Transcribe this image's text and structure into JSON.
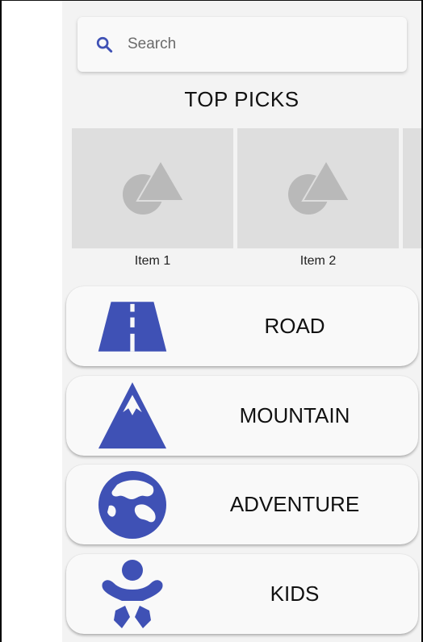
{
  "search": {
    "placeholder": "Search",
    "icon": "search-icon"
  },
  "top_picks": {
    "title": "TOP PICKS",
    "items": [
      {
        "label": "Item 1",
        "icon": "image-placeholder-icon"
      },
      {
        "label": "Item 2",
        "icon": "image-placeholder-icon"
      },
      {
        "label": "",
        "icon": "image-placeholder-icon"
      }
    ]
  },
  "categories": [
    {
      "label": "ROAD",
      "icon": "road-icon"
    },
    {
      "label": "MOUNTAIN",
      "icon": "mountain-icon"
    },
    {
      "label": "ADVENTURE",
      "icon": "globe-icon"
    },
    {
      "label": "KIDS",
      "icon": "baby-icon"
    }
  ],
  "colors": {
    "accent": "#3f51b5",
    "placeholder_shape": "#b9b9b9",
    "thumb_bg": "#dedede"
  }
}
